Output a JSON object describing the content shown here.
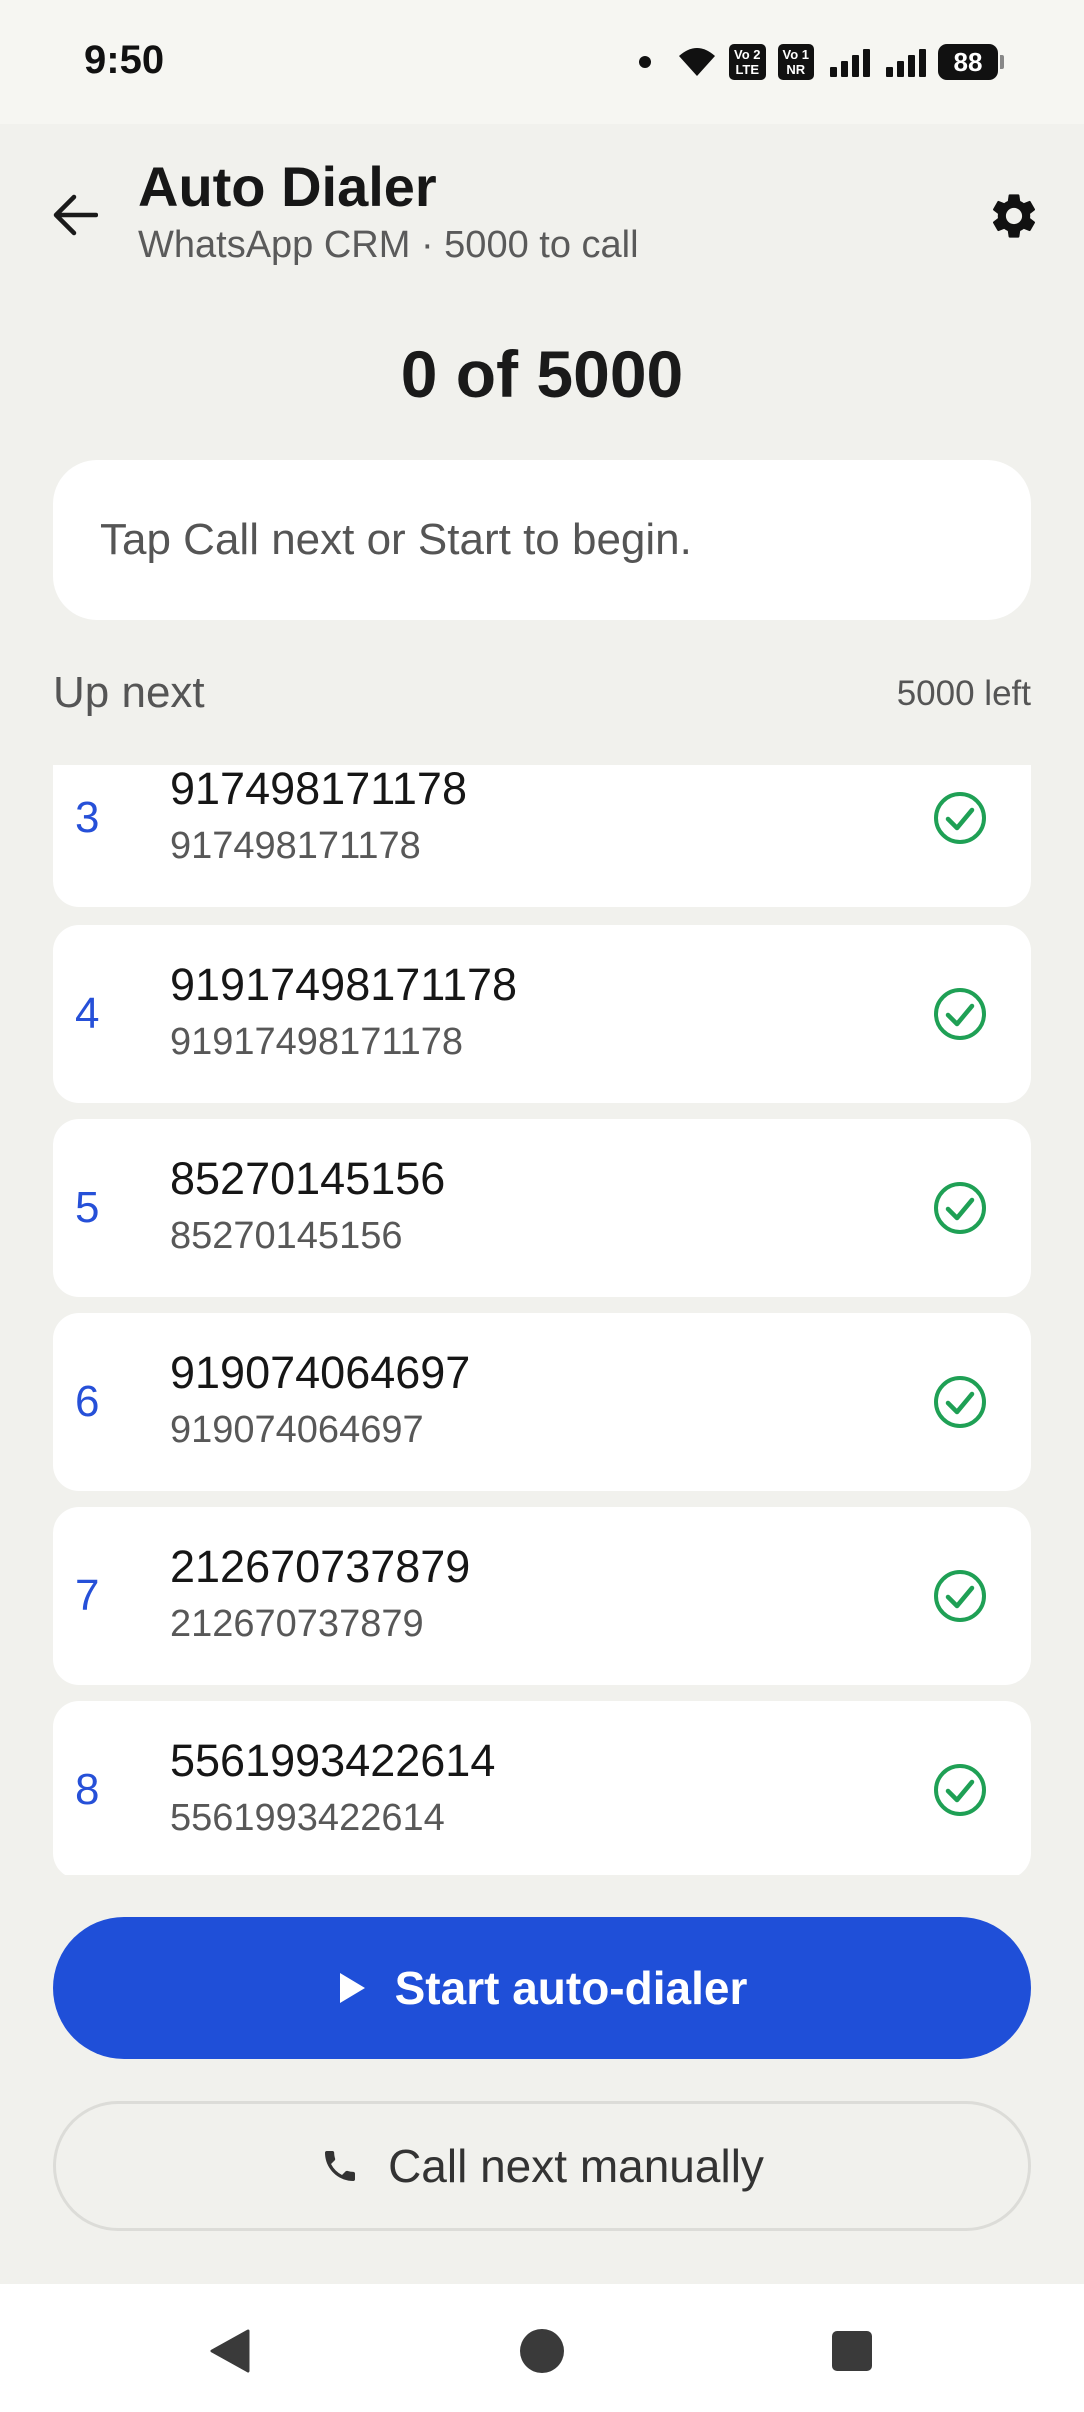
{
  "status_bar": {
    "time": "9:50",
    "volte1_top": "Vo 2",
    "volte1_bottom": "LTE",
    "volte2_top": "Vo 1",
    "volte2_bottom": "NR",
    "battery": "88"
  },
  "header": {
    "title": "Auto Dialer",
    "subtitle": "WhatsApp CRM · 5000 to call"
  },
  "progress_text": "0 of 5000",
  "hint": "Tap Call next or Start to begin.",
  "queue": {
    "heading": "Up next",
    "remaining": "5000 left",
    "items": [
      {
        "index": "3",
        "name": "917498171178",
        "phone": "917498171178"
      },
      {
        "index": "4",
        "name": "91917498171178",
        "phone": "91917498171178"
      },
      {
        "index": "5",
        "name": "85270145156",
        "phone": "85270145156"
      },
      {
        "index": "6",
        "name": "919074064697",
        "phone": "919074064697"
      },
      {
        "index": "7",
        "name": "212670737879",
        "phone": "212670737879"
      },
      {
        "index": "8",
        "name": "5561993422614",
        "phone": "5561993422614"
      }
    ]
  },
  "actions": {
    "start_label": "Start auto-dialer",
    "manual_label": "Call next manually"
  },
  "colors": {
    "accent": "#1f4fd8",
    "index_blue": "#2650d8",
    "check_green": "#1fa055",
    "background": "#f1f1ed"
  },
  "icons": {
    "back": "arrow-left-icon",
    "settings": "gear-icon",
    "check": "check-circle-icon",
    "play": "play-icon",
    "phone": "phone-icon"
  }
}
